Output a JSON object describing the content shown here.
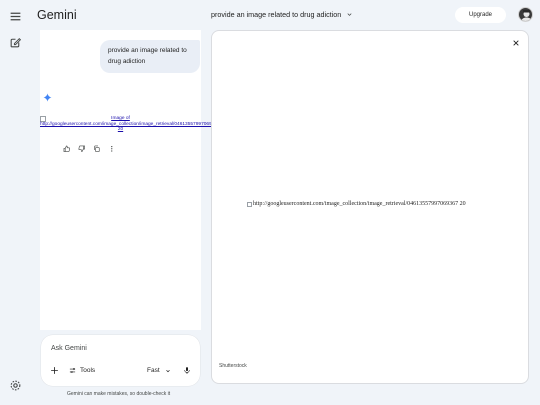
{
  "header": {
    "app_title": "Gemini",
    "conversation_title": "provide an image related to drug adiction",
    "upgrade_label": "Upgrade"
  },
  "rail": {
    "icons": [
      "menu-icon",
      "new-chat-icon",
      "settings-icon"
    ]
  },
  "chat": {
    "user_message": "provide an image related to drug adiction",
    "image_alt": "Image of http://googleusercontent.com/image_collection/image_retrieval/04613557997069367 20",
    "input_placeholder": "Ask Gemini",
    "tools_label": "Tools",
    "mode_label": "Fast",
    "disclaimer": "Gemini can make mistakes, so double-check it"
  },
  "panel": {
    "image_alt": "http://googleusercontent.com/image_collection/image_retrieval/04613557997069367 20",
    "source_label": "Shutterstock"
  },
  "colors": {
    "background": "#f0f4f9",
    "surface": "#ffffff",
    "bubble": "#e9eef6",
    "link": "#1a0dab",
    "gemini_spark": "#4285f4"
  }
}
